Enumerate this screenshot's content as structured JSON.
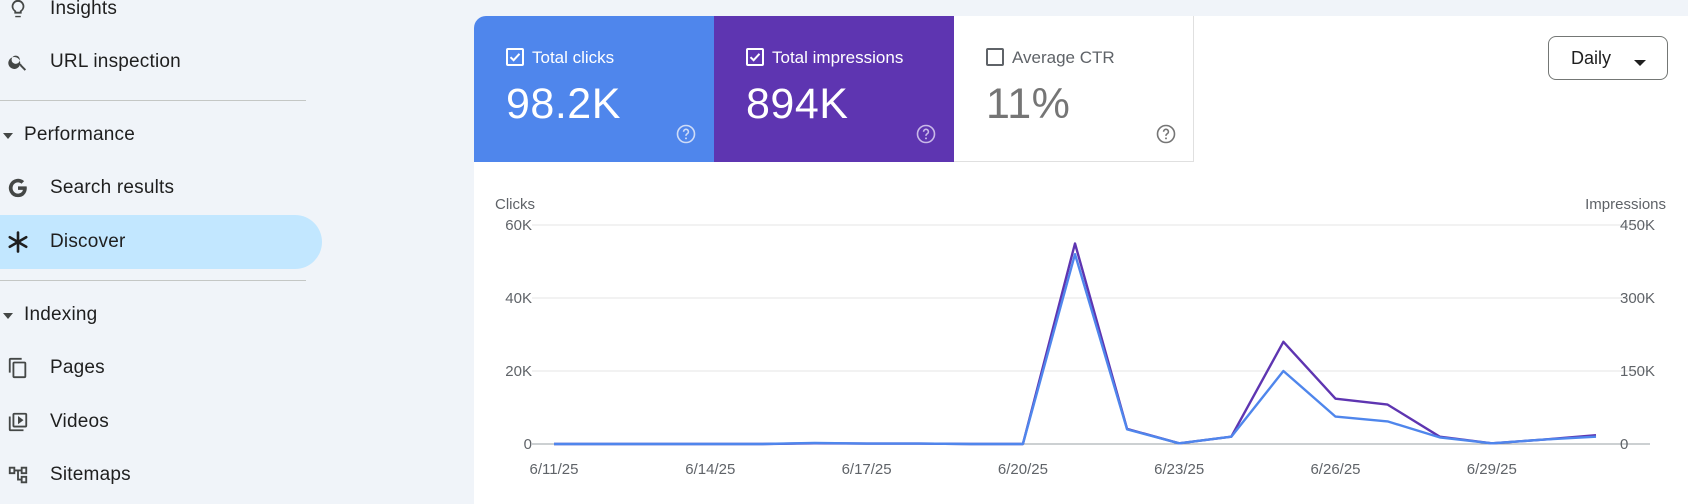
{
  "sidebar": {
    "items": [
      {
        "key": "insights",
        "label": "Insights",
        "icon": "lightbulb-icon"
      },
      {
        "key": "url-inspection",
        "label": "URL inspection",
        "icon": "search-icon"
      },
      {
        "key": "search-results",
        "label": "Search results",
        "icon": "google-g-icon"
      },
      {
        "key": "discover",
        "label": "Discover",
        "icon": "asterisk-icon",
        "active": true
      },
      {
        "key": "pages",
        "label": "Pages",
        "icon": "pages-icon"
      },
      {
        "key": "videos",
        "label": "Videos",
        "icon": "video-icon"
      },
      {
        "key": "sitemaps",
        "label": "Sitemaps",
        "icon": "sitemap-icon"
      }
    ],
    "sections": {
      "performance": "Performance",
      "indexing": "Indexing"
    }
  },
  "metrics": {
    "clicks": {
      "label": "Total clicks",
      "value": "98.2K",
      "checked": true,
      "color": "#4f86ec"
    },
    "impressions": {
      "label": "Total impressions",
      "value": "894K",
      "checked": true,
      "color": "#5e35b1"
    },
    "ctr": {
      "label": "Average CTR",
      "value": "11%",
      "checked": false
    }
  },
  "granularity": {
    "selected": "Daily"
  },
  "chart_data": {
    "type": "line",
    "title": "",
    "y_left_label": "Clicks",
    "y_right_label": "Impressions",
    "y_left_ticks": [
      "0",
      "20K",
      "40K",
      "60K"
    ],
    "y_right_ticks": [
      "0",
      "150K",
      "300K",
      "450K"
    ],
    "y_left_lim": [
      0,
      60000
    ],
    "y_right_lim": [
      0,
      450000
    ],
    "x_tick_labels": [
      "6/11/25",
      "6/14/25",
      "6/17/25",
      "6/20/25",
      "6/23/25",
      "6/26/25",
      "6/29/25"
    ],
    "x": [
      "6/11/25",
      "6/12/25",
      "6/13/25",
      "6/14/25",
      "6/15/25",
      "6/16/25",
      "6/17/25",
      "6/18/25",
      "6/19/25",
      "6/20/25",
      "6/21/25",
      "6/22/25",
      "6/23/25",
      "6/24/25",
      "6/25/25",
      "6/26/25",
      "6/27/25",
      "6/28/25",
      "6/29/25",
      "6/30/25",
      "7/1/25"
    ],
    "grid": true,
    "series": [
      {
        "name": "Total clicks",
        "axis": "left",
        "color": "#4f86ec",
        "values": [
          0,
          0,
          0,
          0,
          0,
          300,
          100,
          100,
          0,
          0,
          52000,
          4000,
          200,
          2000,
          20000,
          7500,
          6200,
          1800,
          200,
          1200,
          2000
        ]
      },
      {
        "name": "Total impressions",
        "axis": "right",
        "color": "#5e35b1",
        "values": [
          0,
          0,
          0,
          0,
          0,
          1500,
          750,
          750,
          0,
          0,
          412000,
          31000,
          1500,
          15000,
          210000,
          93000,
          81000,
          15000,
          1500,
          9000,
          18000
        ]
      }
    ]
  }
}
